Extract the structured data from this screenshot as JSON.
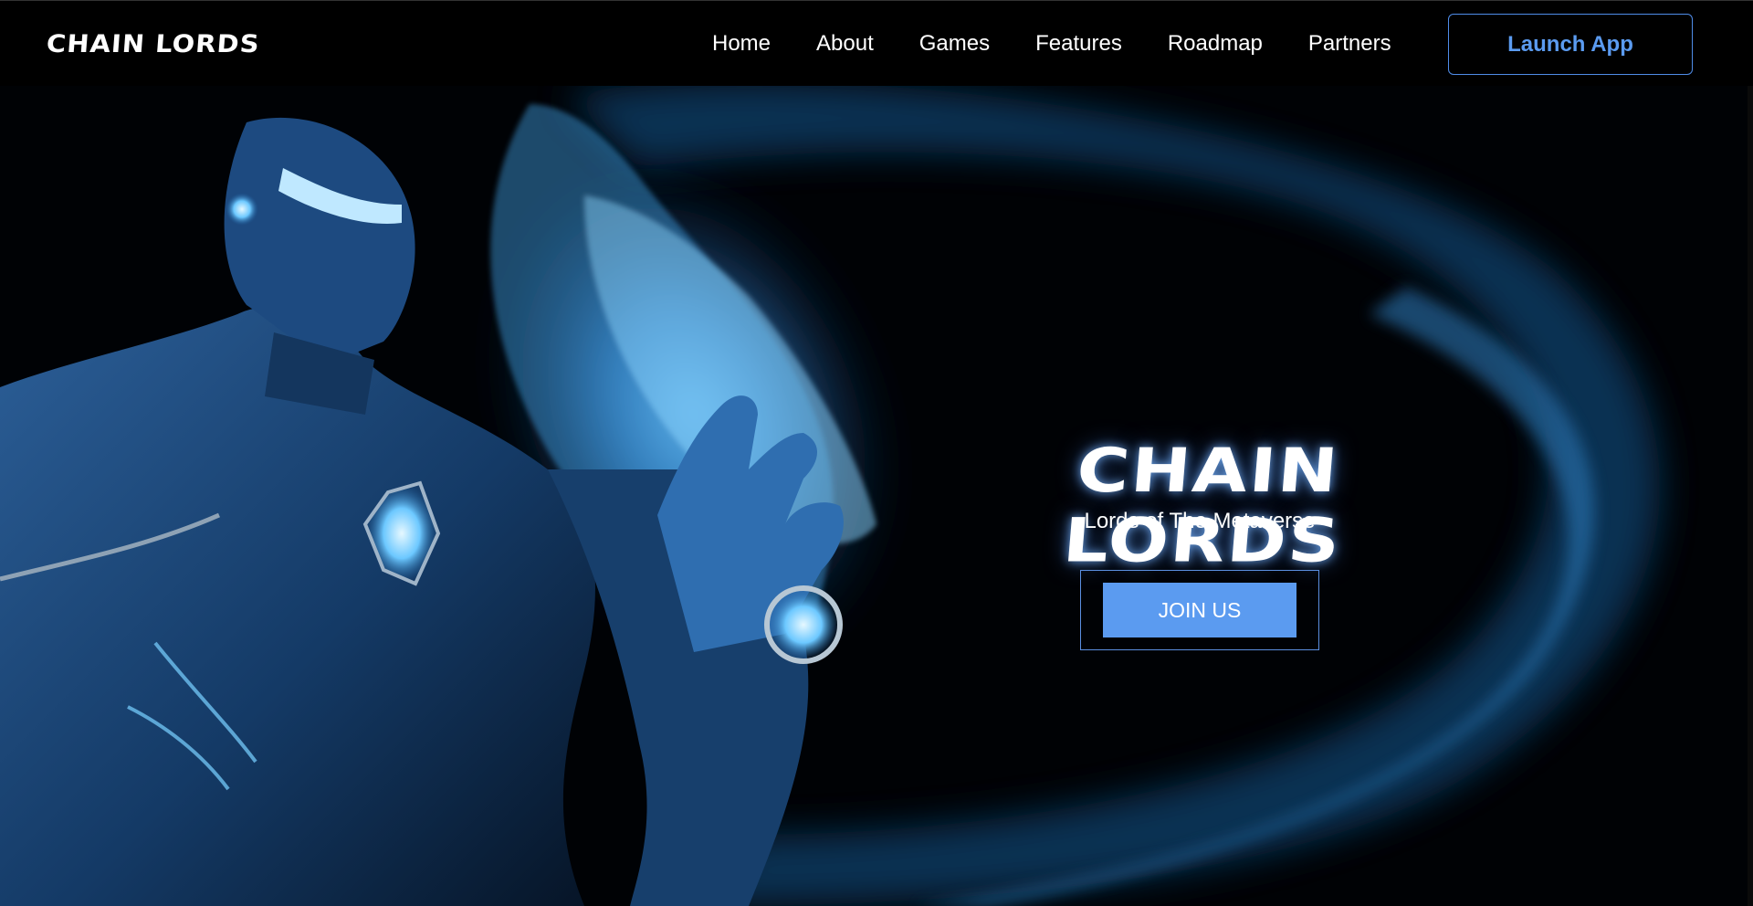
{
  "header": {
    "logo": "CHAIN LORDS",
    "nav": [
      "Home",
      "About",
      "Games",
      "Features",
      "Roadmap",
      "Partners"
    ],
    "launch_label": "Launch App"
  },
  "hero": {
    "title": "CHAIN LORDS",
    "subtitle": "Lords of The Metaverse",
    "cta_label": "JOIN US",
    "image_description_icon": "armored-hero-artwork"
  },
  "colors": {
    "background": "#000000",
    "accent": "#5b9bf0",
    "accent_border": "#4f8ce8",
    "glow": "#62b8ff"
  }
}
